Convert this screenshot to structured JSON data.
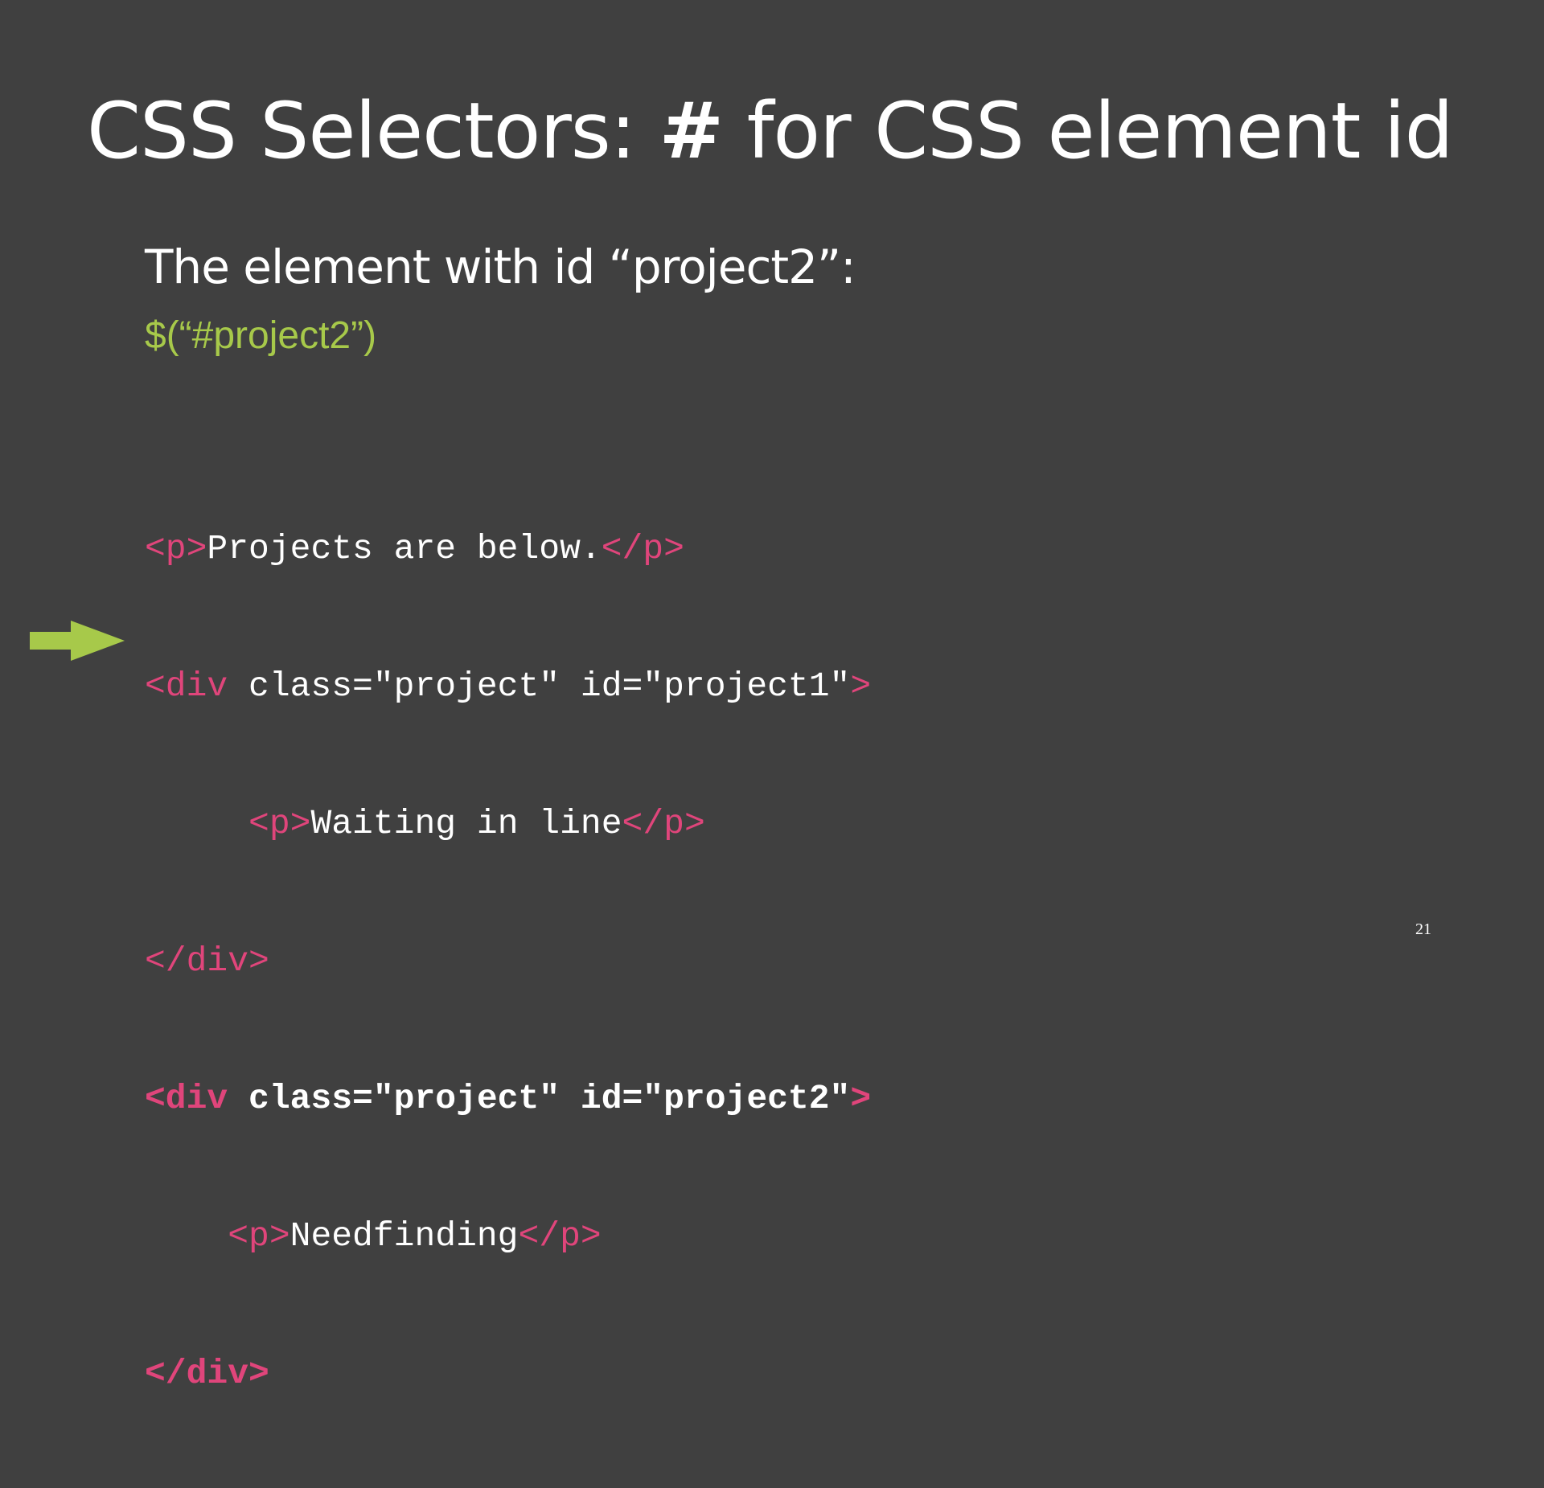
{
  "slide": {
    "title_prefix": "CSS Selectors: ",
    "title_hash": "#",
    "title_suffix": " for CSS element id",
    "subtitle": "The element with id “project2”:",
    "selector_example": "$(“#project2”)",
    "page_number": "21",
    "arrow_icon": "right-arrow-icon"
  },
  "code": {
    "line1": {
      "open_tag": "<p>",
      "text": "Projects are below.",
      "close_tag": "</p>"
    },
    "line2": {
      "tag_start": "<div",
      "attrs": " class=\"project\" id=\"project1\"",
      "tag_end": ">"
    },
    "line3": {
      "indent": "     ",
      "open_tag": "<p>",
      "text": "Waiting in line",
      "close_tag": "</p>"
    },
    "line4": {
      "close_tag": "</div>"
    },
    "line5": {
      "tag_start": "<div",
      "attrs": " class=\"project\" id=\"project2\"",
      "tag_end": ">"
    },
    "line6": {
      "indent": "    ",
      "open_tag": "<p>",
      "text": "Needfinding",
      "close_tag": "</p>"
    },
    "line7": {
      "close_tag": "</div>"
    }
  },
  "colors": {
    "background": "#404040",
    "text": "#ffffff",
    "selector_green": "#a7c94a",
    "tag_pink": "#e0457b",
    "arrow_green": "#a7c94a"
  }
}
